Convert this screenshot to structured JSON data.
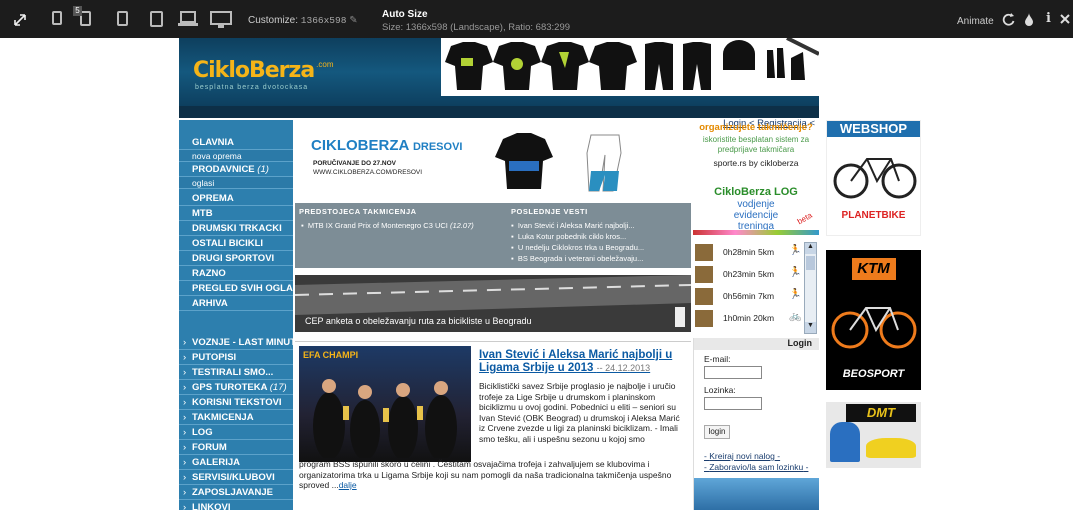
{
  "toolbar": {
    "badge": "5",
    "customize_label": "Customize:",
    "customize_value": "1366x598",
    "title": "Auto Size",
    "subtitle": "Size: 1366x598 (Landscape), Ratio: 683:299",
    "animate_label": "Animate"
  },
  "site": {
    "logo": "CikloBerza",
    "logo_suffix": ".com",
    "logo_tagline": "besplatna berza dvotockasa",
    "header_links": [
      "Login",
      "Registracija"
    ],
    "nav": [
      {
        "label": "GLAVNIA",
        "type": "main"
      },
      {
        "label": "nova oprema",
        "type": "sub"
      },
      {
        "label": "PRODAVNICE",
        "count": "(1)",
        "type": "main"
      },
      {
        "label": "oglasi",
        "type": "sub"
      },
      {
        "label": "OPREMA",
        "type": "main"
      },
      {
        "label": "MTB",
        "type": "main"
      },
      {
        "label": "DRUMSKI TRKACKI",
        "type": "main"
      },
      {
        "label": "OSTALI BICIKLI",
        "type": "main"
      },
      {
        "label": "DRUGI SPORTOVI",
        "type": "main"
      },
      {
        "label": "RAZNO",
        "type": "main"
      },
      {
        "label": "PREGLED SVIH OGLASA",
        "type": "main"
      },
      {
        "label": "ARHIVA",
        "type": "main"
      },
      {
        "label": "VOZNJE - LAST MINUTE",
        "type": "main"
      },
      {
        "label": "PUTOPISI",
        "type": "main"
      },
      {
        "label": "TESTIRALI SMO...",
        "type": "main"
      },
      {
        "label": "GPS TUROTEKA",
        "count": "(17)",
        "type": "main"
      },
      {
        "label": "KORISNI TEKSTOVI",
        "type": "main"
      },
      {
        "label": "TAKMICENJA",
        "type": "main"
      },
      {
        "label": "LOG",
        "type": "main"
      },
      {
        "label": "FORUM",
        "type": "main"
      },
      {
        "label": "GALERIJA",
        "type": "main"
      },
      {
        "label": "SERVISI/KLUBOVI",
        "type": "main"
      },
      {
        "label": "ZAPOSLJAVANJE",
        "type": "main"
      },
      {
        "label": "LINKOVI",
        "type": "main"
      }
    ],
    "banner": {
      "title": "CIKLOBERZA",
      "title_suffix": "DRESOVI",
      "line1": "PORUČIVANJE DO 27.NOV",
      "line2": "WWW.CIKLOBERZA.COM/DRESOVI"
    },
    "news": {
      "left_heading": "PREDSTOJECA TAKMICENJA",
      "left_items": [
        {
          "text": "MTB IX Grand Prix of Montenegro C3 UCI",
          "date": "(12.07)"
        }
      ],
      "right_heading": "POSLEDNJE VESTI",
      "right_items": [
        "Ivan Stević i Aleksa Marić najbolji...",
        "Luka Kotur pobednik ciklo kros...",
        "U nedelju Ciklokros trka u Beogradu...",
        "BS Beograda i veterani obeležavaju..."
      ]
    },
    "cep_caption": "CEP anketa o obeležavanju ruta za bicikliste u Beogradu",
    "article": {
      "image_text": "EFA CHAMPI",
      "title": "Ivan Stević i Aleksa Marić najbolji u Ligama Srbije u 2013",
      "date": "-- 24.12.2013",
      "body_side": "Biciklistički savez Srbije proglasio je najbolje i uručio trofeje za Lige Srbije u drumskom i planinskom biciklizmu u ovoj godini. Pobednici u eliti – seniori su Ivan Stević (OBK Beograd) u drumskoj i Aleksa Marić iz Crvene zvezde u ligi za planinski biciklizam. - Imali smo tešku, ali i uspešnu sezonu u kojoj smo",
      "body_full": "program BSS ispunili skoro u celini . Čestitam osvajačima trofeja i zahvaljujem se klubovima i organizatorima trka u Ligama Srbije koji su nam pomogli da naša tradicionalna takmičenja uspešno sproved ...",
      "more": "dalje"
    },
    "right": {
      "promo_title": "organizujete takmičenje?",
      "promo_text": "iskoristite besplatan sistem za predprijave takmičara",
      "promo_sign": "sporte.rs by cikloberza",
      "log_title": "CikloBerza LOG",
      "log_sub": "vodjenje evidencije treninga",
      "log_badge": "beta",
      "feed": [
        {
          "text": "0h28min 5km",
          "icon": "runner-icon"
        },
        {
          "text": "0h23min 5km",
          "icon": "runner-icon"
        },
        {
          "text": "0h56min 7km",
          "icon": "runner-icon"
        },
        {
          "text": "1h0min 20km",
          "icon": "bicycle-icon"
        }
      ],
      "login_heading": "Login",
      "email_label": "E-mail:",
      "password_label": "Lozinka:",
      "login_button": "login",
      "links": [
        "Kreiraj novi nalog",
        "Zaboravio/la sam lozinku"
      ]
    },
    "ads": [
      {
        "label": "WEBSHOP",
        "brand": "PLANETBIKE"
      },
      {
        "label": "KTM",
        "brand": "BEOSPORT"
      },
      {
        "label": "DMT",
        "brand": ""
      }
    ]
  }
}
